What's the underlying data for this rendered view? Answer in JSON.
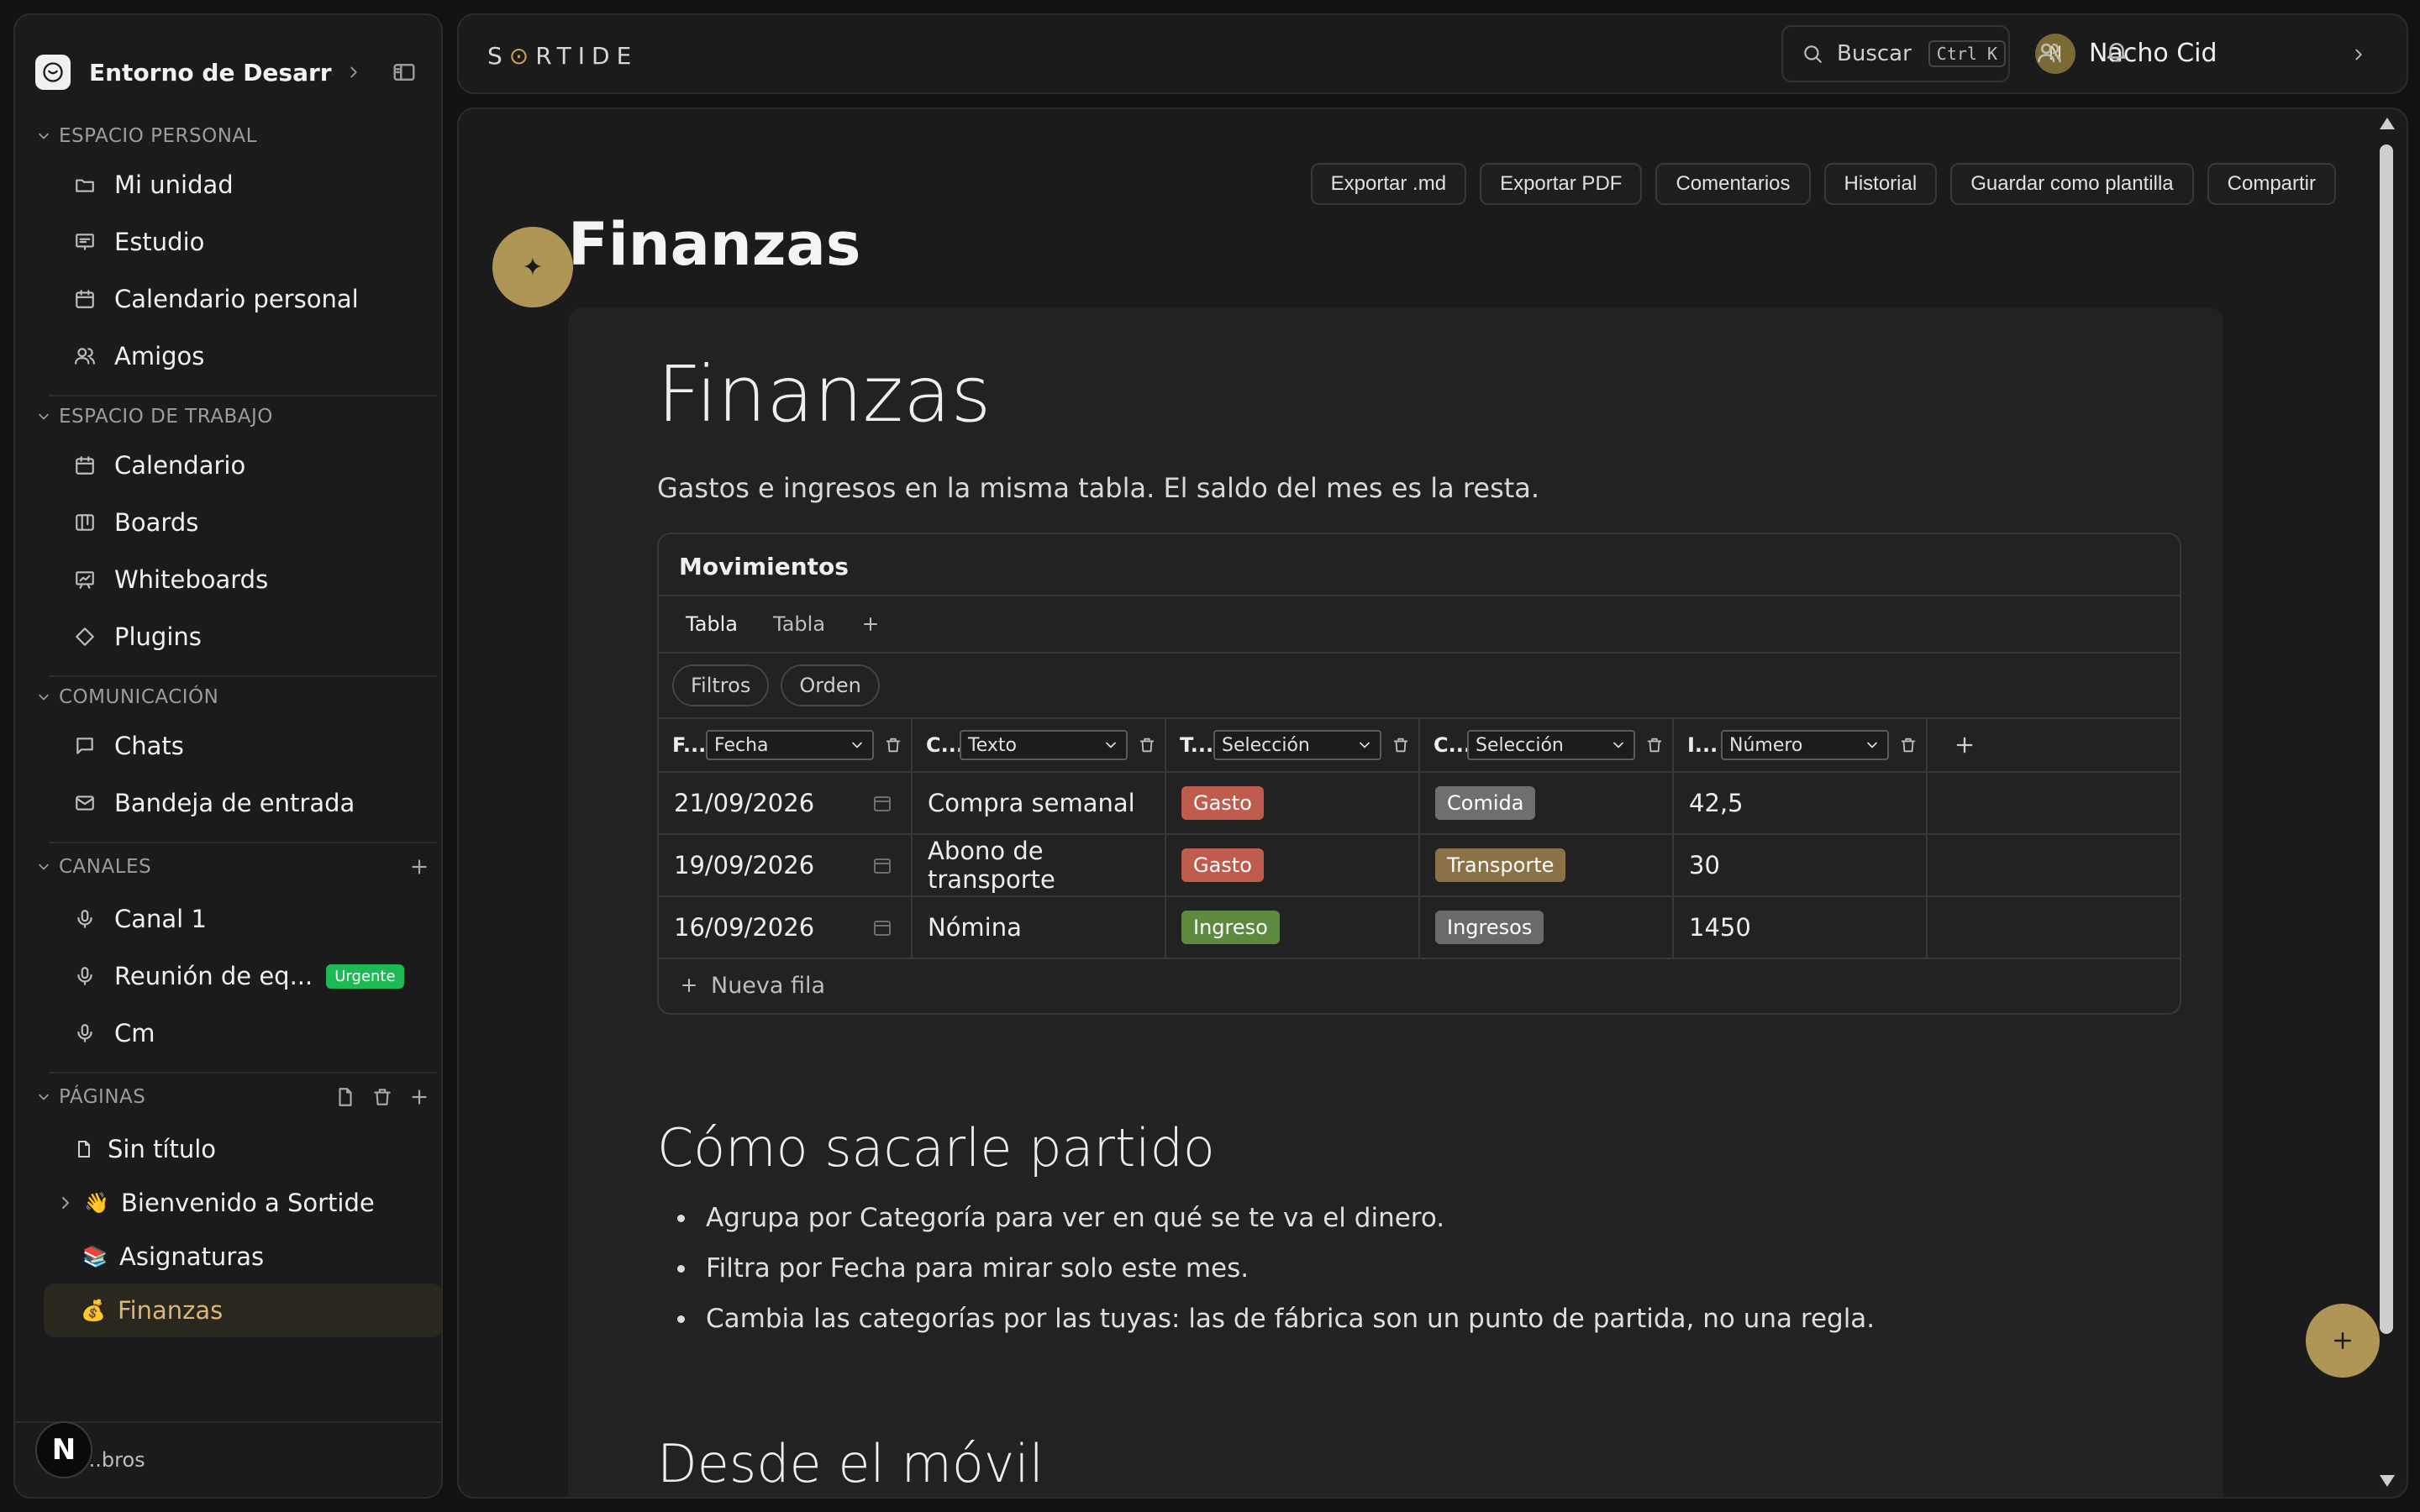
{
  "workspace": {
    "title": "Entorno de Desarrol..."
  },
  "sections": {
    "personal": {
      "label": "ESPACIO PERSONAL",
      "items": [
        {
          "label": "Mi unidad",
          "icon": "folder-icon"
        },
        {
          "label": "Estudio",
          "icon": "presentation-icon"
        },
        {
          "label": "Calendario personal",
          "icon": "calendar-icon"
        },
        {
          "label": "Amigos",
          "icon": "users-icon"
        }
      ]
    },
    "workspace": {
      "label": "ESPACIO DE TRABAJO",
      "items": [
        {
          "label": "Calendario",
          "icon": "calendar-icon"
        },
        {
          "label": "Boards",
          "icon": "board-icon"
        },
        {
          "label": "Whiteboards",
          "icon": "whiteboard-icon"
        },
        {
          "label": "Plugins",
          "icon": "puzzle-icon"
        }
      ]
    },
    "communication": {
      "label": "COMUNICACIÓN",
      "items": [
        {
          "label": "Chats",
          "icon": "chat-icon"
        },
        {
          "label": "Bandeja de entrada",
          "icon": "mail-icon"
        }
      ]
    },
    "channels": {
      "label": "CANALES",
      "items": [
        {
          "label": "Canal 1",
          "icon": "mic-icon"
        },
        {
          "label": "Reunión de eq...",
          "icon": "mic-icon",
          "badge": "Urgente"
        },
        {
          "label": "Cm",
          "icon": "mic-icon"
        }
      ]
    },
    "pages": {
      "label": "PÁGINAS",
      "items": [
        {
          "label": "Sin título",
          "glyph": "file"
        },
        {
          "label": "Bienvenido a Sortide",
          "glyph": "👋"
        },
        {
          "label": "Asignaturas",
          "glyph": "📚"
        },
        {
          "label": "Finanzas",
          "glyph": "💰",
          "active": true
        }
      ]
    }
  },
  "sidebar_footer": {
    "text": "...bros"
  },
  "topbar": {
    "brand": "SORTIDE",
    "search_label": "Buscar",
    "search_shortcut": "Ctrl K",
    "user_initial": "N",
    "user_name": "Nacho Cid"
  },
  "actions": [
    "Exportar .md",
    "Exportar PDF",
    "Comentarios",
    "Historial",
    "Guardar como plantilla",
    "Compartir"
  ],
  "page": {
    "title": "Finanzas",
    "heading": "Finanzas",
    "intro": "Gastos e ingresos en la misma tabla. El saldo del mes es la resta."
  },
  "database": {
    "title": "Movimientos",
    "tabs": [
      "Tabla",
      "Tabla"
    ],
    "filters": [
      "Filtros",
      "Orden"
    ],
    "columns": [
      {
        "abbr": "F...",
        "type": "Fecha"
      },
      {
        "abbr": "C...",
        "type": "Texto"
      },
      {
        "abbr": "T...",
        "type": "Selección"
      },
      {
        "abbr": "C...",
        "type": "Selección"
      },
      {
        "abbr": "I...",
        "type": "Número"
      }
    ],
    "rows": [
      {
        "date": "21/09/2026",
        "concept": "Compra semanal",
        "type": "Gasto",
        "category": "Comida",
        "amount": "42,5"
      },
      {
        "date": "19/09/2026",
        "concept": "Abono de transporte",
        "type": "Gasto",
        "category": "Transporte",
        "amount": "30"
      },
      {
        "date": "16/09/2026",
        "concept": "Nómina",
        "type": "Ingreso",
        "category": "Ingresos",
        "amount": "1450"
      }
    ],
    "new_row": "Nueva fila"
  },
  "tips": {
    "heading": "Cómo sacarle partido",
    "items": [
      "Agrupa por Categoría para ver en qué se te va el dinero.",
      "Filtra por Fecha para mirar solo este mes.",
      "Cambia las categorías por las tuyas: las de fábrica son un punto de partida, no una regla."
    ]
  },
  "mobile": {
    "heading": "Desde el móvil"
  },
  "colors": {
    "accent": "#b09656",
    "gasto": "#c05c4e",
    "ingreso": "#5e8a3f",
    "urgent": "#1db954"
  }
}
